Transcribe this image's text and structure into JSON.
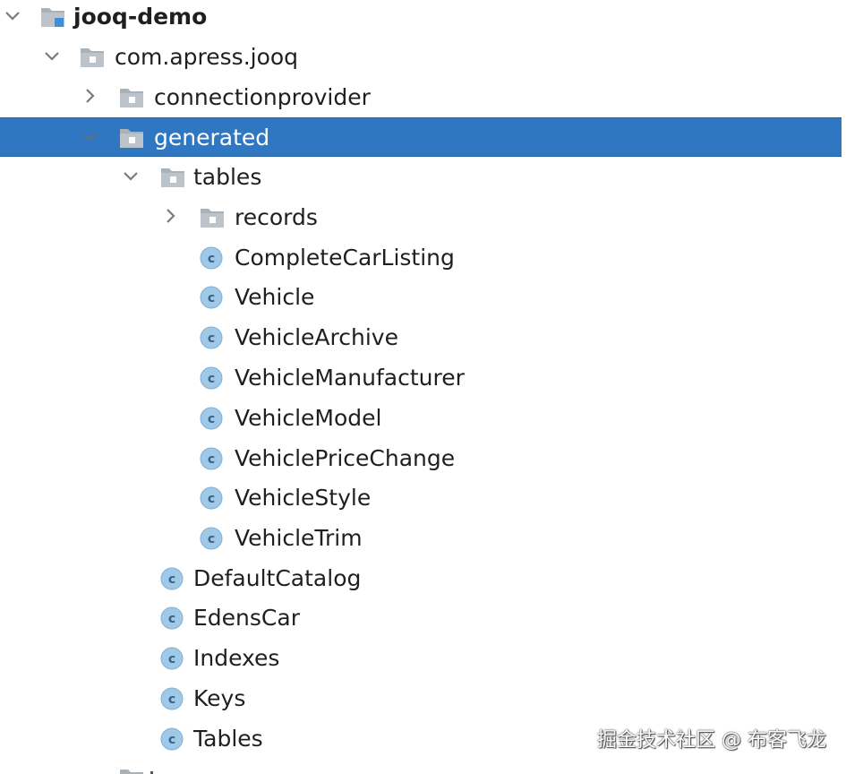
{
  "tree": {
    "root": {
      "label": "jooq-demo",
      "icon": "module-folder-icon",
      "expanded": true
    },
    "package": {
      "label": "com.apress.jooq",
      "icon": "package-folder-icon",
      "expanded": true
    },
    "connectionprovider": {
      "label": "connectionprovider",
      "icon": "package-folder-icon",
      "expanded": false
    },
    "generated": {
      "label": "generated",
      "icon": "package-folder-icon",
      "expanded": true,
      "selected": true
    },
    "tables": {
      "label": "tables",
      "icon": "package-folder-icon",
      "expanded": true
    },
    "records": {
      "label": "records",
      "icon": "package-folder-icon",
      "expanded": false
    },
    "table_classes": [
      {
        "label": "CompleteCarListing",
        "icon": "class-icon"
      },
      {
        "label": "Vehicle",
        "icon": "class-icon"
      },
      {
        "label": "VehicleArchive",
        "icon": "class-icon"
      },
      {
        "label": "VehicleManufacturer",
        "icon": "class-icon"
      },
      {
        "label": "VehicleModel",
        "icon": "class-icon"
      },
      {
        "label": "VehiclePriceChange",
        "icon": "class-icon"
      },
      {
        "label": "VehicleStyle",
        "icon": "class-icon"
      },
      {
        "label": "VehicleTrim",
        "icon": "class-icon"
      }
    ],
    "generated_classes": [
      {
        "label": "DefaultCatalog",
        "icon": "class-icon"
      },
      {
        "label": "EdensCar",
        "icon": "class-icon"
      },
      {
        "label": "Indexes",
        "icon": "class-icon"
      },
      {
        "label": "Keys",
        "icon": "class-icon"
      },
      {
        "label": "Tables",
        "icon": "class-icon"
      }
    ]
  },
  "watermark": "掘金技术社区 @ 布客飞龙",
  "colors": {
    "selection": "#2f77c0",
    "folder": "#a9b1b9",
    "class_icon_bg": "#9fc9e7",
    "class_icon_letter": "#3c5f86",
    "module_marker": "#3d8fdc"
  }
}
